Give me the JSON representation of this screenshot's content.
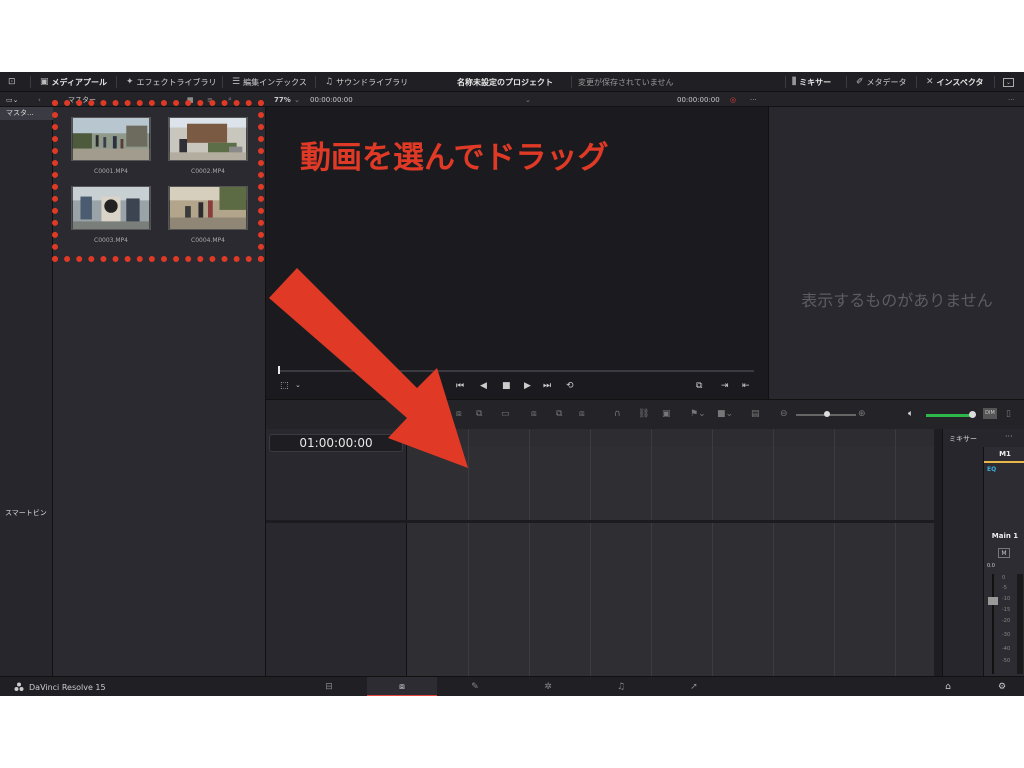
{
  "topbar": {
    "media_pool": "メディアプール",
    "effects_library": "エフェクトライブラリ",
    "edit_index": "編集インデックス",
    "sound_library": "サウンドライブラリ",
    "project_title": "名称未設定のプロジェクト",
    "save_status": "変更が保存されていません",
    "mixer": "ミキサー",
    "metadata": "メタデータ",
    "inspector": "インスペクタ"
  },
  "subbar": {
    "bin_label": "マスター",
    "zoom": "77%",
    "source_timecode": "00:00:00:00",
    "record_timecode": "00:00:00:00"
  },
  "bins": {
    "master": "マスタ...",
    "smart_bins": "スマートビン"
  },
  "clips": [
    {
      "name": "C0001.MP4"
    },
    {
      "name": "C0002.MP4"
    },
    {
      "name": "C0003.MP4"
    },
    {
      "name": "C0004.MP4"
    }
  ],
  "inspector": {
    "empty_message": "表示するものがありません"
  },
  "timeline": {
    "timecode": "01:00:00:00"
  },
  "mixer": {
    "title": "ミキサー",
    "track": "M1",
    "eq": "EQ",
    "bus": "Main 1",
    "mute": "M",
    "fader_value": "0.0",
    "scale": [
      "0",
      "-5",
      "-10",
      "-15",
      "-20",
      "-30",
      "-40",
      "-50"
    ],
    "dim": "DIM"
  },
  "bottombar": {
    "app_name": "DaVinci Resolve 15"
  },
  "annotation": {
    "callout": "動画を選んでドラッグ"
  },
  "colors": {
    "annotation_red": "#e03a26",
    "volume_green": "#2fb84a",
    "active_page_red": "#e0443a",
    "track_yellow": "#e8b64a"
  }
}
